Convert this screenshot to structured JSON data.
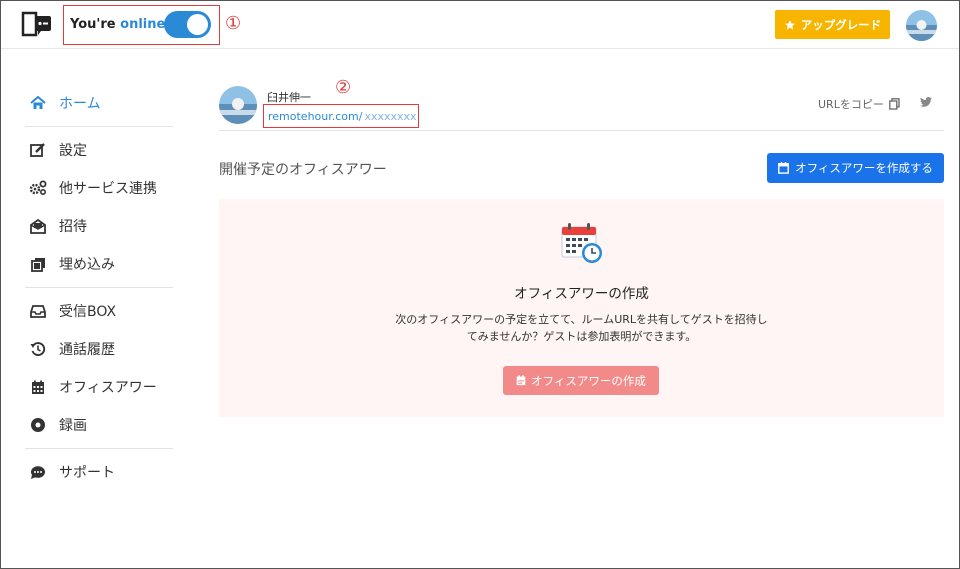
{
  "header": {
    "status_prefix": "You're ",
    "status_value": "online",
    "marker1": "①",
    "upgrade_label": "アップグレード"
  },
  "sidebar": {
    "items": [
      {
        "label": "ホーム",
        "icon": "home-icon",
        "active": true
      },
      {
        "label": "設定",
        "icon": "edit-icon"
      },
      {
        "label": "他サービス連携",
        "icon": "cogs-icon"
      },
      {
        "label": "招待",
        "icon": "envelope-open-icon"
      },
      {
        "label": "埋め込み",
        "icon": "copy-icon"
      },
      {
        "label": "受信BOX",
        "icon": "inbox-icon"
      },
      {
        "label": "通話履歴",
        "icon": "history-icon"
      },
      {
        "label": "オフィスアワー",
        "icon": "calendar-icon"
      },
      {
        "label": "録画",
        "icon": "record-icon"
      },
      {
        "label": "サポート",
        "icon": "chat-icon"
      }
    ]
  },
  "profile": {
    "name": "臼井伸一",
    "marker2": "②",
    "url_domain": "remotehour.com/",
    "url_room": "xxxxxxxx",
    "copy_label": "URLをコピー"
  },
  "office_hours": {
    "section_title": "開催予定のオフィスアワー",
    "create_button_label": "オフィスアワーを作成する",
    "empty_title": "オフィスアワーの作成",
    "empty_desc_line1": "次のオフィスアワーの予定を立てて、ルームURLを共有してゲストを招待し",
    "empty_desc_line2": "てみませんか？ゲストは参加表明ができます。",
    "empty_button_label": "オフィスアワーの作成"
  },
  "colors": {
    "accent": "#2b8ad6",
    "upgrade": "#f7b500",
    "primary_button": "#1a73e8",
    "panel_bg": "#fff5f5",
    "panel_button": "#f38a8a",
    "annotation": "#e23b3b"
  }
}
